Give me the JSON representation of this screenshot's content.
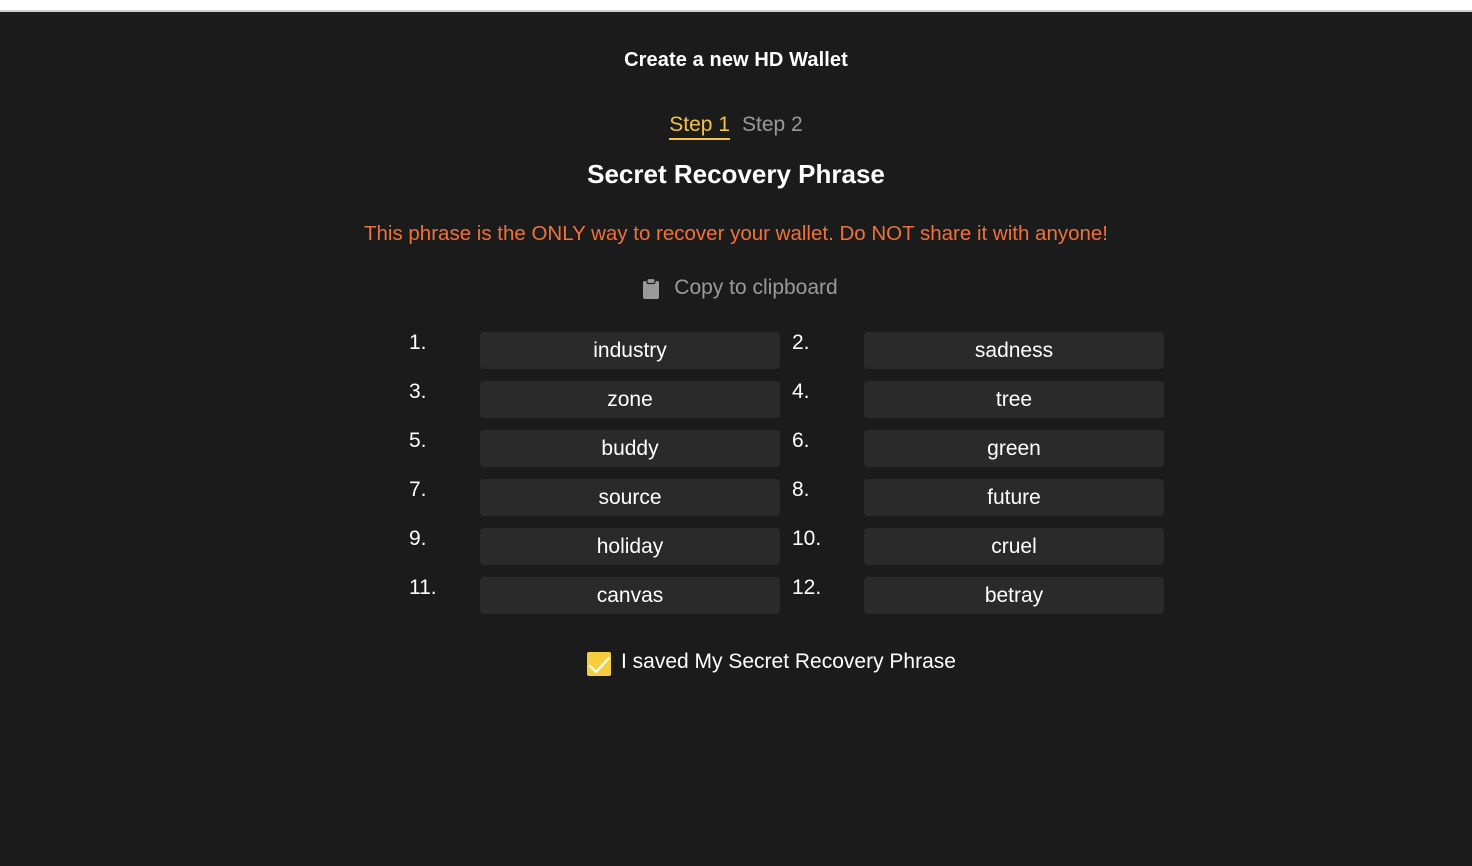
{
  "window": {
    "title": "Create a new HD Wallet"
  },
  "stepper": {
    "steps": [
      {
        "label": "Step 1",
        "active": true
      },
      {
        "label": "Step 2",
        "active": false
      }
    ]
  },
  "main": {
    "heading": "Secret Recovery Phrase",
    "warning": "This phrase is the ONLY way to recover your wallet. Do NOT share it with anyone!",
    "copy_label": "Copy to clipboard",
    "copy_icon": "clipboard-icon"
  },
  "phrase": {
    "words": [
      {
        "num": "1.",
        "word": "industry"
      },
      {
        "num": "2.",
        "word": "sadness"
      },
      {
        "num": "3.",
        "word": "zone"
      },
      {
        "num": "4.",
        "word": "tree"
      },
      {
        "num": "5.",
        "word": "buddy"
      },
      {
        "num": "6.",
        "word": "green"
      },
      {
        "num": "7.",
        "word": "source"
      },
      {
        "num": "8.",
        "word": "future"
      },
      {
        "num": "9.",
        "word": "holiday"
      },
      {
        "num": "10.",
        "word": "cruel"
      },
      {
        "num": "11.",
        "word": "canvas"
      },
      {
        "num": "12.",
        "word": "betray"
      }
    ]
  },
  "confirm": {
    "label": "I saved My Secret Recovery Phrase",
    "checked": true,
    "icon": "checkmark-icon"
  },
  "colors": {
    "background": "#1c1b1c",
    "accent": "#f5c243",
    "warning": "#f0713a",
    "muted": "#9a9a9a",
    "word_box": "#2a2a2a"
  }
}
